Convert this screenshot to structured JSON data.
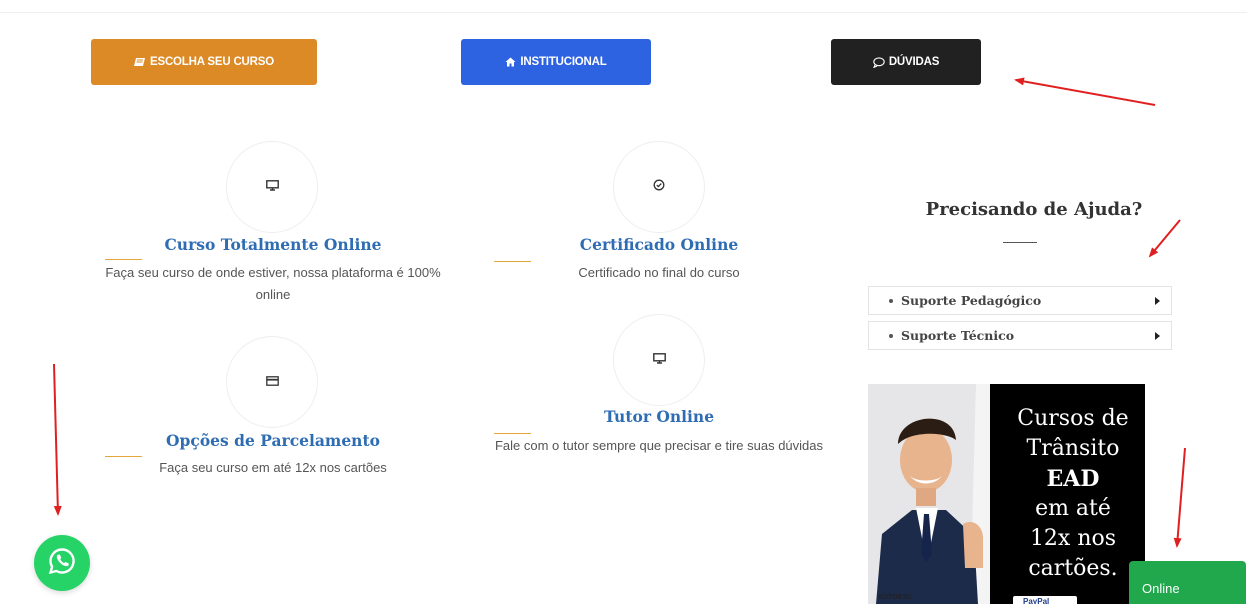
{
  "nav": {
    "courses_label": "ESCOLHA SEU CURSO",
    "institutional_label": "INSTITUCIONAL",
    "faq_label": "DÚVIDAS"
  },
  "features": {
    "online": {
      "title": "Curso Totalmente Online",
      "desc": "Faça seu curso de onde estiver, nossa plataforma é 100% online"
    },
    "certificate": {
      "title": "Certificado Online",
      "desc": "Certificado no final do curso"
    },
    "installments": {
      "title": "Opções de Parcelamento",
      "desc": "Faça seu curso em até 12x nos cartões"
    },
    "tutor": {
      "title": "Tutor Online",
      "desc": "Fale com o tutor sempre que precisar e tire suas dúvidas"
    }
  },
  "help": {
    "title": "Precisando de Ajuda?",
    "items": [
      {
        "label": "Suporte Pedagógico"
      },
      {
        "label": "Suporte Técnico"
      }
    ]
  },
  "banner": {
    "line1": "Cursos de",
    "line2": "Trânsito",
    "line3": "EAD",
    "line4": "em até",
    "line5": "12x nos",
    "line6": "cartões.",
    "brand": "AUTOESC",
    "payment": "PayPal"
  },
  "chat": {
    "status_label": "Online"
  },
  "colors": {
    "courses_button": "#dc8a26",
    "institutional_button": "#2d63e0",
    "faq_button": "#212121",
    "feature_title": "#2e6db3",
    "online_badge": "#21a84c",
    "whatsapp": "#25d366",
    "annotation_arrow": "#e02020"
  },
  "icons": {
    "courses": "book-icon",
    "institutional": "home-icon",
    "faq": "speech-bubble-icon",
    "online": "monitor-icon",
    "certificate": "check-circle-icon",
    "installments": "credit-card-icon",
    "tutor": "monitor-icon",
    "whatsapp": "whatsapp-icon"
  }
}
